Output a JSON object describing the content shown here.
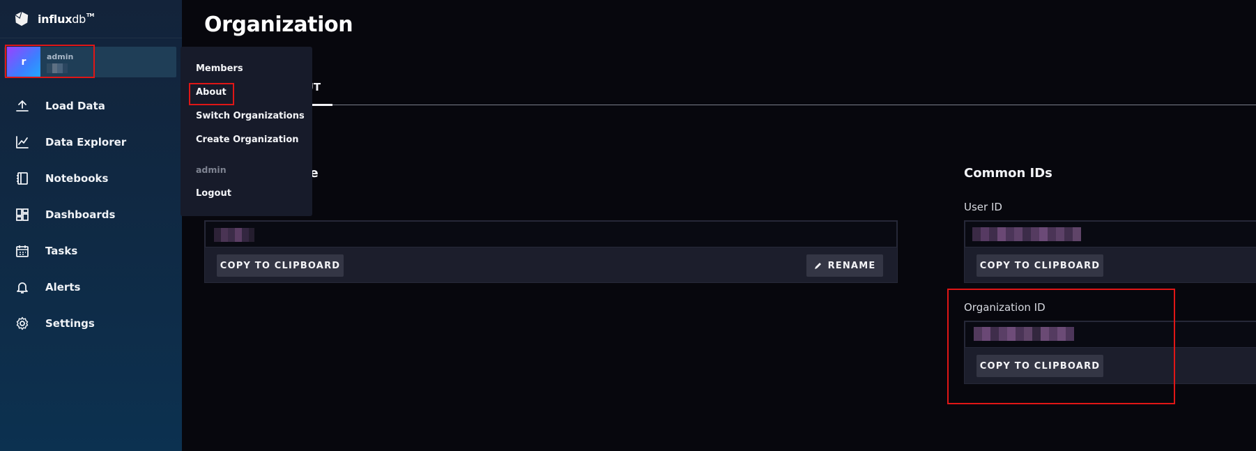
{
  "app": {
    "logo_text_bold": "influx",
    "logo_text_light": "db",
    "logo_mark": "TM"
  },
  "org_switcher": {
    "avatar_letter": "r",
    "org_name": "admin"
  },
  "nav": {
    "items": [
      {
        "label": "Load Data",
        "icon": "upload-icon"
      },
      {
        "label": "Data Explorer",
        "icon": "graph-icon"
      },
      {
        "label": "Notebooks",
        "icon": "notebook-icon"
      },
      {
        "label": "Dashboards",
        "icon": "dashboards-icon"
      },
      {
        "label": "Tasks",
        "icon": "calendar-icon"
      },
      {
        "label": "Alerts",
        "icon": "bell-icon"
      },
      {
        "label": "Settings",
        "icon": "gear-icon"
      }
    ]
  },
  "dropdown": {
    "members": "Members",
    "about": "About",
    "switch_orgs": "Switch Organizations",
    "create_org": "Create Organization",
    "user_heading": "admin",
    "logout": "Logout"
  },
  "page": {
    "title": "Organization",
    "tab_label": "OUT",
    "profile_heading": "file",
    "common_ids_heading": "Common IDs",
    "user_id_label": "User ID",
    "org_id_label": "Organization ID",
    "copy_label": "COPY TO CLIPBOARD",
    "rename_label": "RENAME"
  },
  "colors": {
    "highlight": "#e01616",
    "accent_gradient_start": "#9b41ff",
    "accent_gradient_end": "#22a8ff"
  }
}
